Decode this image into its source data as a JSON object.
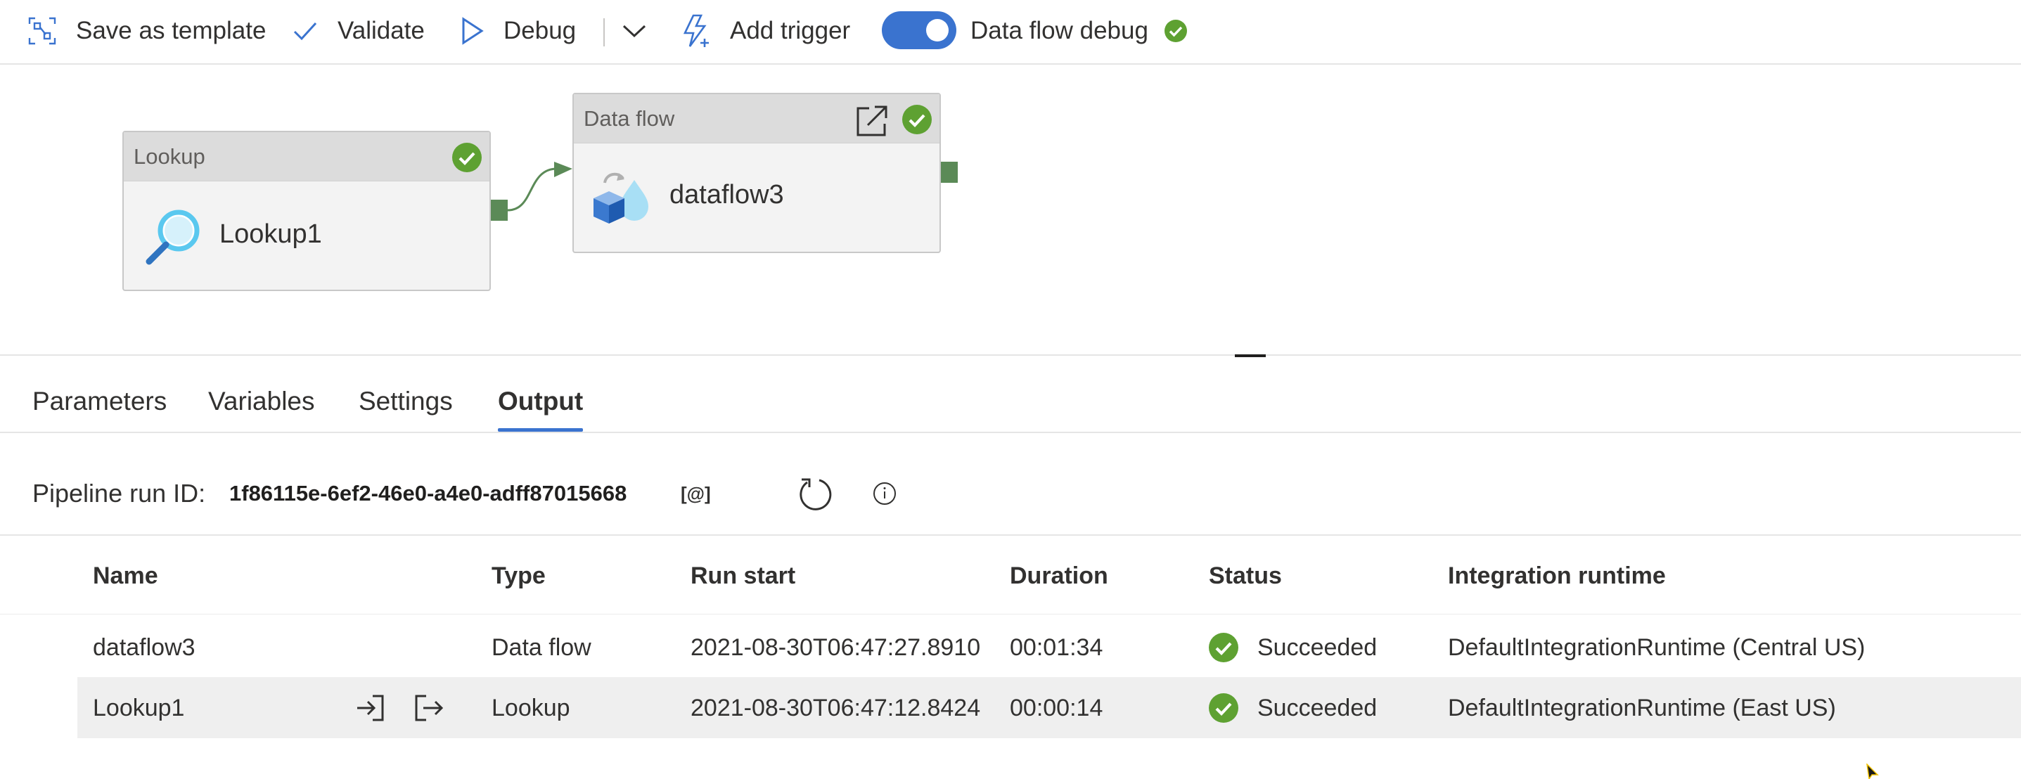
{
  "toolbar": {
    "save_template": "Save as template",
    "validate": "Validate",
    "debug": "Debug",
    "add_trigger": "Add trigger",
    "data_flow_debug": "Data flow debug",
    "data_flow_debug_on": true
  },
  "pipeline": {
    "lookup_node": {
      "type": "Lookup",
      "name": "Lookup1",
      "status": "succeeded"
    },
    "dataflow_node": {
      "type": "Data flow",
      "name": "dataflow3",
      "status": "succeeded"
    }
  },
  "tabs": [
    {
      "label": "Parameters",
      "active": false
    },
    {
      "label": "Variables",
      "active": false
    },
    {
      "label": "Settings",
      "active": false
    },
    {
      "label": "Output",
      "active": true
    }
  ],
  "output": {
    "run_id_label": "Pipeline run ID:",
    "run_id": "1f86115e-6ef2-46e0-a4e0-adff87015668",
    "copy_label": "[@]",
    "columns": [
      "Name",
      "Type",
      "Run start",
      "Duration",
      "Status",
      "Integration runtime"
    ],
    "rows": [
      {
        "name": "dataflow3",
        "type": "Data flow",
        "run_start": "2021-08-30T06:47:27.8910",
        "duration": "00:01:34",
        "status": "Succeeded",
        "runtime": "DefaultIntegrationRuntime (Central US)"
      },
      {
        "name": "Lookup1",
        "type": "Lookup",
        "run_start": "2021-08-30T06:47:12.8424",
        "duration": "00:00:14",
        "status": "Succeeded",
        "runtime": "DefaultIntegrationRuntime (East US)"
      }
    ]
  },
  "colors": {
    "accent": "#3a73cf",
    "success": "#5ea132",
    "port": "#5b8a57"
  }
}
